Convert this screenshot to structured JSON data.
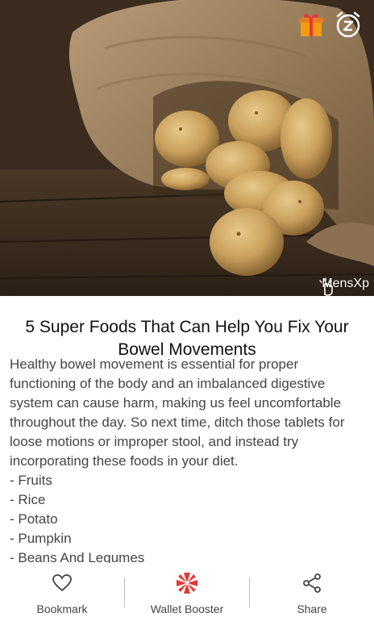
{
  "hero": {
    "source_label": "MensXp",
    "gift_icon": "gift-icon",
    "snooze_icon": "snooze-icon"
  },
  "article": {
    "title": "5 Super Foods That Can Help You Fix Your Bowel Movements",
    "intro": "Healthy bowel movement is essential for proper functioning of the body and an imbalanced digestive system can cause harm, making us feel uncomfortable throughout the day. So next time, ditch those tablets for loose motions or improper stool, and instead try incorporating these foods in your diet.",
    "list": [
      "- Fruits",
      "- Rice",
      "- Potato",
      "- Pumpkin",
      "- Beans And Legumes"
    ]
  },
  "bottom_bar": {
    "bookmark_label": "Bookmark",
    "wallet_label": "Wallet Booster",
    "share_label": "Share"
  },
  "colors": {
    "accent_red": "#e53935",
    "gift_orange": "#f39c12",
    "text_dark": "#111111",
    "text_body": "#444444"
  }
}
